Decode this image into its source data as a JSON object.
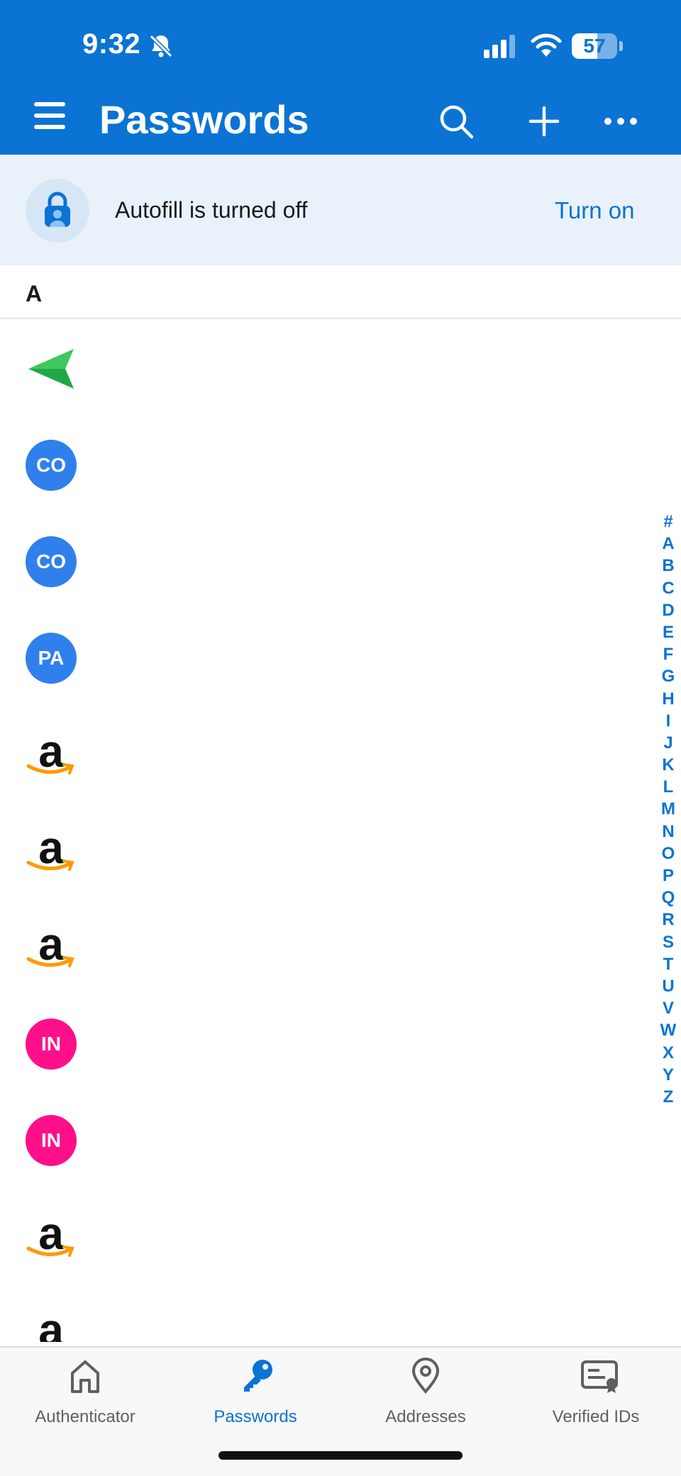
{
  "status": {
    "time": "9:32",
    "battery": "57",
    "battery_level": 0.57
  },
  "header": {
    "title": "Passwords",
    "menu_icon": "hamburger-icon",
    "actions": [
      "search-icon",
      "add-icon",
      "more-icon"
    ]
  },
  "banner": {
    "text": "Autofill is turned off",
    "action": "Turn on",
    "icon": "lock-person-icon"
  },
  "section": {
    "letter": "A"
  },
  "entries": [
    {
      "logo": "send-arrow",
      "title": "",
      "subtitle": ""
    },
    {
      "logo": "initials",
      "initials": "CO",
      "color": "#2f80ed",
      "title": "",
      "subtitle": ""
    },
    {
      "logo": "initials",
      "initials": "CO",
      "color": "#2f80ed",
      "title": "",
      "subtitle": ""
    },
    {
      "logo": "initials",
      "initials": "PA",
      "color": "#2f80ed",
      "title": "",
      "subtitle": ""
    },
    {
      "logo": "amazon",
      "title": "",
      "subtitle": ""
    },
    {
      "logo": "amazon",
      "title": "",
      "subtitle": ""
    },
    {
      "logo": "amazon",
      "title": "",
      "subtitle": ""
    },
    {
      "logo": "initials",
      "initials": "IN",
      "color": "#ff0f8a",
      "title": "",
      "subtitle": ""
    },
    {
      "logo": "initials",
      "initials": "IN",
      "color": "#ff0f8a",
      "title": "",
      "subtitle": ""
    },
    {
      "logo": "amazon",
      "title": "",
      "subtitle": ""
    },
    {
      "logo": "amazon",
      "title": "",
      "subtitle": ""
    }
  ],
  "index_letters": [
    "#",
    "A",
    "B",
    "C",
    "D",
    "E",
    "F",
    "G",
    "H",
    "I",
    "J",
    "K",
    "L",
    "M",
    "N",
    "O",
    "P",
    "Q",
    "R",
    "S",
    "T",
    "U",
    "V",
    "W",
    "X",
    "Y",
    "Z"
  ],
  "tabs": [
    {
      "label": "Authenticator",
      "icon": "home-icon",
      "active": false
    },
    {
      "label": "Passwords",
      "icon": "key-icon",
      "active": true
    },
    {
      "label": "Addresses",
      "icon": "location-pin-icon",
      "active": false
    },
    {
      "label": "Verified IDs",
      "icon": "id-card-icon",
      "active": false
    }
  ],
  "colors": {
    "brand": "#0a73d4",
    "banner_bg": "#e9f2fb",
    "tab_active": "#0a73d4"
  }
}
